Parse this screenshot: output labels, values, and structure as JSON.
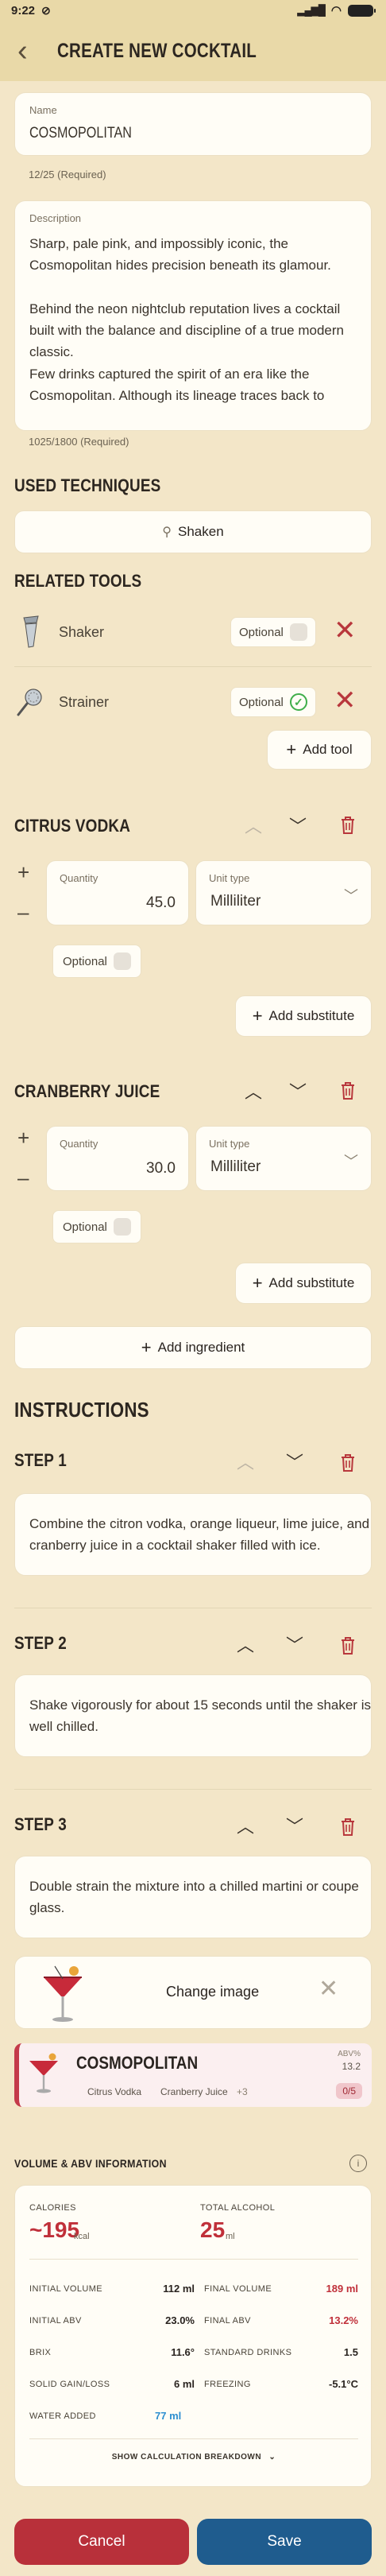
{
  "status": {
    "time": "9:22"
  },
  "header": {
    "title": "CREATE NEW COCKTAIL"
  },
  "name_field": {
    "label": "Name",
    "value": "COSMOPOLITAN",
    "helper": "12/25 (Required)"
  },
  "description_field": {
    "label": "Description",
    "p1": "Sharp, pale pink, and impossibly iconic, the Cosmopolitan hides precision beneath its glamour.",
    "p2": "Behind the neon nightclub reputation lives a cocktail built with the balance and discipline of a true modern classic.",
    "p3": "Few drinks captured the spirit of an era like the Cosmopolitan. Although its lineage traces back to",
    "helper": "1025/1800 (Required)"
  },
  "techniques": {
    "title": "USED TECHNIQUES",
    "items": [
      "Shaken"
    ]
  },
  "tools": {
    "title": "RELATED TOOLS",
    "items": [
      {
        "name": "Shaker",
        "optional_label": "Optional",
        "optional": false
      },
      {
        "name": "Strainer",
        "optional_label": "Optional",
        "optional": true
      }
    ],
    "add_label": "Add tool"
  },
  "ingredients": [
    {
      "name": "CITRUS VODKA",
      "quantity_label": "Quantity",
      "quantity": "45.0",
      "unit_label": "Unit type",
      "unit": "Milliliter",
      "optional_label": "Optional",
      "substitute_label": "Add substitute"
    },
    {
      "name": "CRANBERRY JUICE",
      "quantity_label": "Quantity",
      "quantity": "30.0",
      "unit_label": "Unit type",
      "unit": "Milliliter",
      "optional_label": "Optional",
      "substitute_label": "Add substitute"
    }
  ],
  "add_ingredient_label": "Add ingredient",
  "instructions": {
    "title": "INSTRUCTIONS",
    "steps": [
      {
        "title": "STEP 1",
        "line1": "Combine the citron vodka, orange liqueur, lime juice, and",
        "line2": "cranberry juice in a cocktail shaker filled with ice."
      },
      {
        "title": "STEP 2",
        "line1": "Shake vigorously for about 15 seconds until the shaker is",
        "line2": "well chilled."
      },
      {
        "title": "STEP 3",
        "line1": "Double strain the mixture into a chilled martini or coupe",
        "line2": "glass."
      }
    ]
  },
  "image": {
    "change_label": "Change image"
  },
  "summary": {
    "name": "COSMOPOLITAN",
    "tags": [
      "Citrus Vodka",
      "Cranberry Juice",
      "+3"
    ],
    "abv_label": "ABV%",
    "abv": "13.2",
    "score": "0/5"
  },
  "volume_info": {
    "title": "VOLUME & ABV INFORMATION",
    "calories_label": "CALORIES",
    "calories": "~195",
    "calories_unit": "kcal",
    "alcohol_label": "TOTAL ALCOHOL",
    "alcohol": "25",
    "alcohol_unit": "ml",
    "rows": [
      {
        "l1": "INITIAL VOLUME",
        "v1": "112 ml",
        "l2": "FINAL VOLUME",
        "v2": "189 ml"
      },
      {
        "l1": "INITIAL ABV",
        "v1": "23.0%",
        "l2": "FINAL ABV",
        "v2": "13.2%"
      },
      {
        "l1": "BRIX",
        "v1": "11.6°",
        "l2": "STANDARD DRINKS",
        "v2": "1.5"
      },
      {
        "l1": "SOLID GAIN/LOSS",
        "v1": "6 ml",
        "l2": "FREEZING",
        "v2": "-5.1°C"
      },
      {
        "l1": "WATER ADDED",
        "v1": "77 ml",
        "l2": "",
        "v2": ""
      }
    ],
    "breakdown_label": "SHOW CALCULATION BREAKDOWN"
  },
  "actions": {
    "cancel": "Cancel",
    "save": "Save"
  },
  "colors": {
    "background": "#f3e6c8",
    "header": "#e9d9a8",
    "cancel": "#b8303a",
    "save": "#1f5c8e",
    "accent_red": "#b8373c"
  }
}
